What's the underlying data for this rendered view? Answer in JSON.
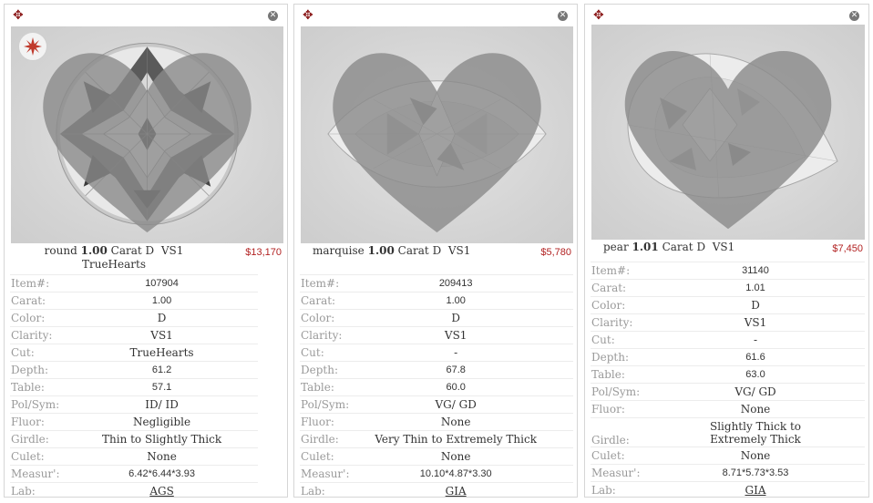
{
  "spec_labels": {
    "item": "Item#:",
    "carat": "Carat:",
    "color": "Color:",
    "clarity": "Clarity:",
    "cut": "Cut:",
    "depth": "Depth:",
    "table": "Table:",
    "polsym": "Pol/Sym:",
    "fluor": "Fluor:",
    "girdle": "Girdle:",
    "culet": "Culet:",
    "measur": "Measur':",
    "lab": "Lab:"
  },
  "icons": {
    "move": "move-arrows-icon",
    "close": "close-icon",
    "favorite": "heart-icon",
    "badge": "truehearts-badge-icon"
  },
  "colors": {
    "move_icon": "#8b1a1a",
    "price": "#b22222",
    "label": "#9a9a9a"
  },
  "cards": [
    {
      "shape": "round",
      "carat_value": "1.00",
      "carat_word": "Carat",
      "color": "D",
      "clarity": "VS1",
      "brand": "TrueHearts",
      "price": "$13,170",
      "specs": {
        "item": "107904",
        "carat": "1.00",
        "color": "D",
        "clarity": "VS1",
        "cut": "TrueHearts",
        "depth": "61.2",
        "table": "57.1",
        "polsym": "ID/ ID",
        "fluor": "Negligible",
        "girdle": "Thin to Slightly Thick",
        "culet": "None",
        "measur": "6.42*6.44*3.93",
        "lab": "AGS"
      }
    },
    {
      "shape": "marquise",
      "carat_value": "1.00",
      "carat_word": "Carat",
      "color": "D",
      "clarity": "VS1",
      "price": "$5,780",
      "specs": {
        "item": "209413",
        "carat": "1.00",
        "color": "D",
        "clarity": "VS1",
        "cut": "-",
        "depth": "67.8",
        "table": "60.0",
        "polsym": "VG/ GD",
        "fluor": "None",
        "girdle": "Very Thin to Extremely Thick",
        "culet": "None",
        "measur": "10.10*4.87*3.30",
        "lab": "GIA"
      }
    },
    {
      "shape": "pear",
      "carat_value": "1.01",
      "carat_word": "Carat",
      "color": "D",
      "clarity": "VS1",
      "price": "$7,450",
      "specs": {
        "item": "31140",
        "carat": "1.01",
        "color": "D",
        "clarity": "VS1",
        "cut": "-",
        "depth": "61.6",
        "table": "63.0",
        "polsym": "VG/ GD",
        "fluor": "None",
        "girdle": "Slightly Thick to Extremely Thick",
        "culet": "None",
        "measur": "8.71*5.73*3.53",
        "lab": "GIA"
      }
    }
  ]
}
